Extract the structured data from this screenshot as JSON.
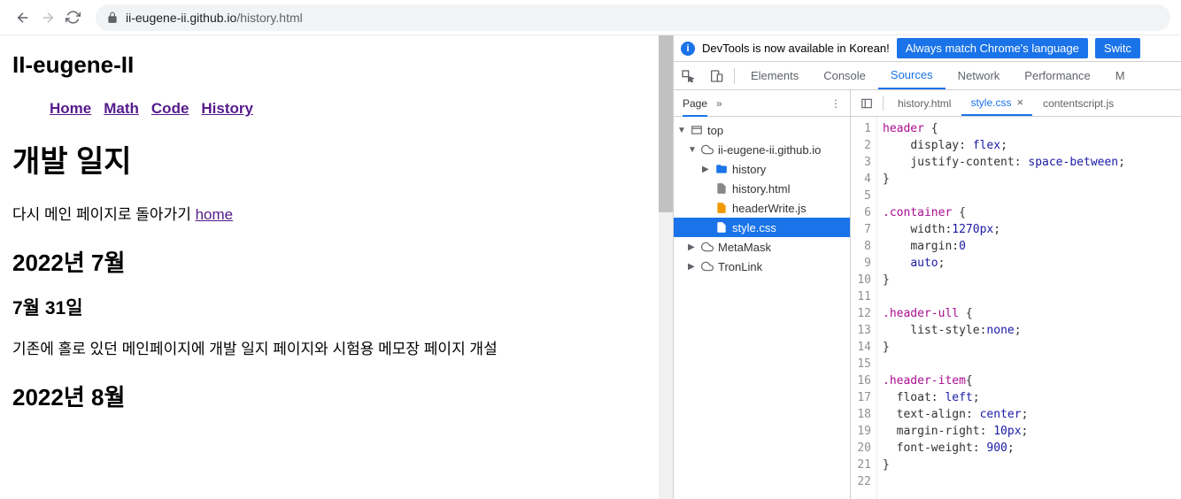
{
  "browser": {
    "url_domain": "ii-eugene-ii.github.io",
    "url_path": "/history.html"
  },
  "page": {
    "site_title": "II-eugene-II",
    "nav": [
      "Home",
      "Math",
      "Code",
      "History"
    ],
    "h1": "개발 일지",
    "para1_text": "다시 메인 페이지로 돌아가기 ",
    "para1_link": "home",
    "h2_1": "2022년 7월",
    "h3_1": "7월 31일",
    "para2": "기존에 홀로 있던 메인페이지에 개발 일지 페이지와 시험용 메모장 페이지 개설",
    "h2_2": "2022년 8월"
  },
  "devtools": {
    "banner_text": "DevTools is now available in Korean!",
    "banner_btn1": "Always match Chrome's language",
    "banner_btn2": "Switc",
    "tabs": [
      "Elements",
      "Console",
      "Sources",
      "Network",
      "Performance",
      "M"
    ],
    "nav_header": "Page",
    "tree": {
      "top": "top",
      "domain": "ii-eugene-ii.github.io",
      "folder": "history",
      "files": [
        "history.html",
        "headerWrite.js",
        "style.css"
      ],
      "ext1": "MetaMask",
      "ext2": "TronLink"
    },
    "editor_tabs": [
      "history.html",
      "style.css",
      "contentscript.js"
    ],
    "code_lines": [
      {
        "n": 1,
        "html": "<span class='c-sel'>header</span> {"
      },
      {
        "n": 2,
        "html": "    <span class='c-prop'>display</span>: <span class='c-val'>flex</span>;"
      },
      {
        "n": 3,
        "html": "    <span class='c-prop'>justify-content</span>: <span class='c-val'>space-between</span>;"
      },
      {
        "n": 4,
        "html": "}"
      },
      {
        "n": 5,
        "html": ""
      },
      {
        "n": 6,
        "html": "<span class='c-class'>.container</span> {"
      },
      {
        "n": 7,
        "html": "    <span class='c-prop'>width</span>:<span class='c-val'>1270px</span>;"
      },
      {
        "n": 8,
        "html": "    <span class='c-prop'>margin</span>:<span class='c-val'>0</span>"
      },
      {
        "n": 9,
        "html": "    <span class='c-val'>auto</span>;"
      },
      {
        "n": 10,
        "html": "}"
      },
      {
        "n": 11,
        "html": ""
      },
      {
        "n": 12,
        "html": "<span class='c-class'>.header-ull</span> {"
      },
      {
        "n": 13,
        "html": "    <span class='c-prop'>list-style</span>:<span class='c-val'>none</span>;"
      },
      {
        "n": 14,
        "html": "}"
      },
      {
        "n": 15,
        "html": ""
      },
      {
        "n": 16,
        "html": "<span class='c-class'>.header-item</span>{"
      },
      {
        "n": 17,
        "html": "  <span class='c-prop'>float</span>: <span class='c-val'>left</span>;"
      },
      {
        "n": 18,
        "html": "  <span class='c-prop'>text-align</span>: <span class='c-val'>center</span>;"
      },
      {
        "n": 19,
        "html": "  <span class='c-prop'>margin-right</span>: <span class='c-val'>10px</span>;"
      },
      {
        "n": 20,
        "html": "  <span class='c-prop'>font-weight</span>: <span class='c-val'>900</span>;"
      },
      {
        "n": 21,
        "html": "}"
      },
      {
        "n": 22,
        "html": ""
      }
    ]
  }
}
